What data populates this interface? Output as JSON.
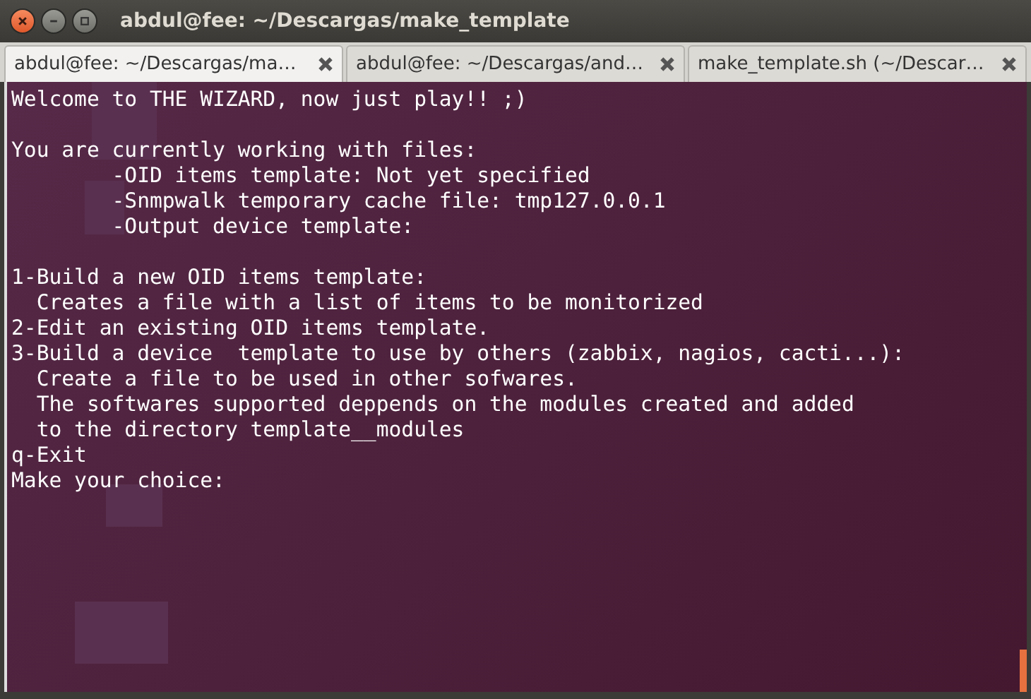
{
  "window": {
    "title": "abdul@fee: ~/Descargas/make_template"
  },
  "tabs": [
    {
      "label": "abdul@fee: ~/Descargas/ma…",
      "selected": true
    },
    {
      "label": "abdul@fee: ~/Descargas/and…",
      "selected": false
    },
    {
      "label": "make_template.sh (~/Descar…",
      "selected": false
    }
  ],
  "terminal": {
    "blocks": [
      [
        "Welcome to THE WIZARD, now just play!! ;)"
      ],
      [
        "You are currently working with files:",
        "        -OID items template: Not yet specified",
        "        -Snmpwalk temporary cache file: tmp127.0.0.1",
        "        -Output device template:"
      ],
      [
        "1-Build a new OID items template:",
        "  Creates a file with a list of items to be monitorized",
        "2-Edit an existing OID items template.",
        "3-Build a device  template to use by others (zabbix, nagios, cacti...):",
        "  Create a file to be used in other sofwares.",
        "  The softwares supported deppends on the modules created and added",
        "  to the directory template__modules",
        "q-Exit",
        "Make your choice:"
      ]
    ]
  }
}
